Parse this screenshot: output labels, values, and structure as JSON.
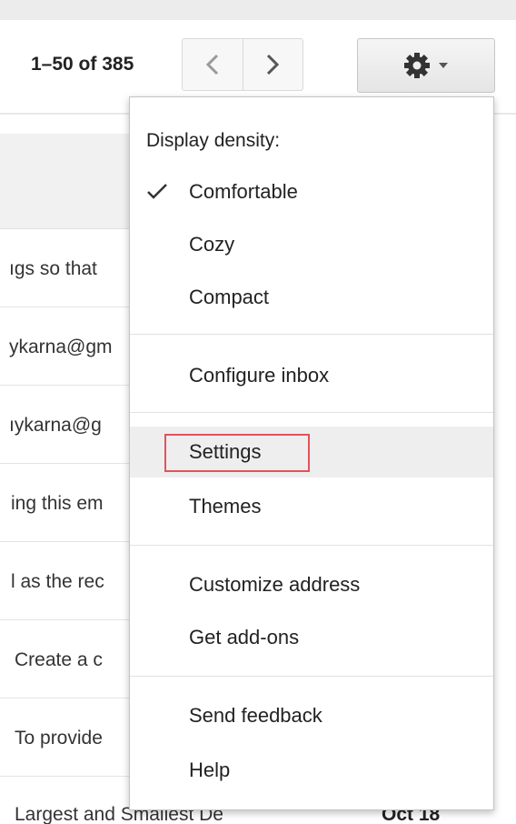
{
  "toolbar": {
    "page_count": "1–50 of 385",
    "prev_icon": "chevron-left-icon",
    "next_icon": "chevron-right-icon",
    "settings_icon": "gear-icon",
    "dropdown_icon": "caret-down-icon"
  },
  "inbox_rows": [
    {
      "text": "ıgs so that"
    },
    {
      "text": "ykarna@gm"
    },
    {
      "text": "ıykarna@g"
    },
    {
      "text": "ing this em"
    },
    {
      "text": "l as the rec"
    },
    {
      "text": "Create a c"
    },
    {
      "text": "To provide"
    }
  ],
  "bottom_row": {
    "text": "Largest and Smallest De",
    "date": "Oct 18"
  },
  "menu": {
    "heading": "Display density:",
    "items": [
      {
        "label": "Comfortable",
        "checked": true
      },
      {
        "label": "Cozy"
      },
      {
        "label": "Compact"
      },
      {
        "label": "Configure inbox"
      },
      {
        "label": "Settings",
        "highlighted": true
      },
      {
        "label": "Themes"
      },
      {
        "label": "Customize address"
      },
      {
        "label": "Get add-ons"
      },
      {
        "label": "Send feedback"
      },
      {
        "label": "Help"
      }
    ]
  },
  "colors": {
    "highlight_outline": "#e4525a",
    "menu_hover": "#eeeeee"
  }
}
